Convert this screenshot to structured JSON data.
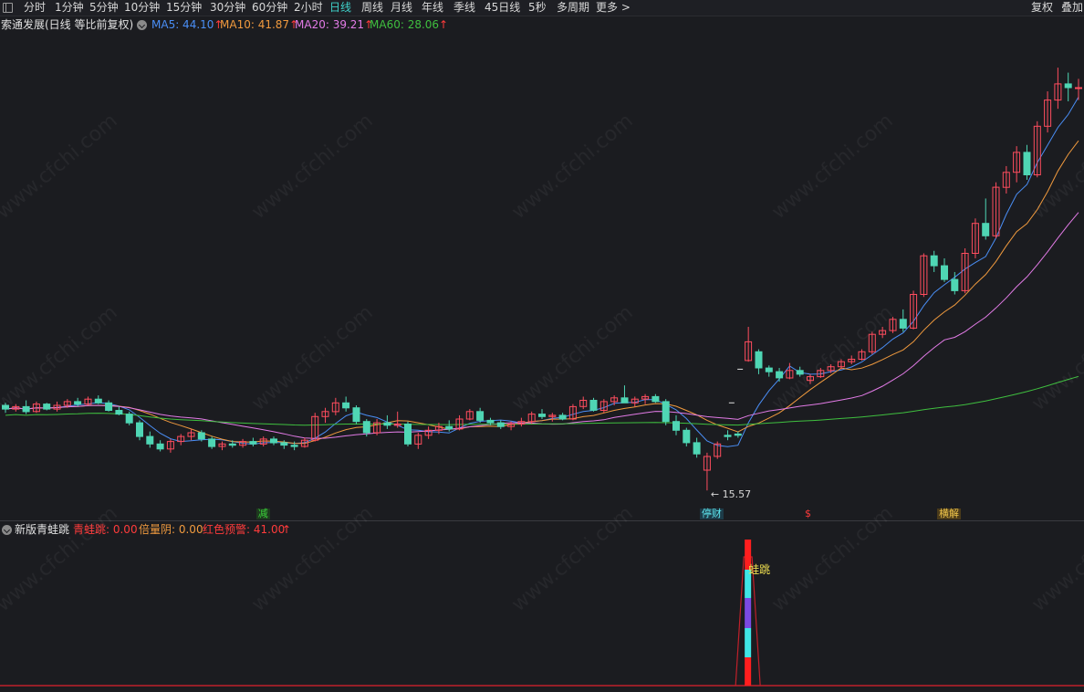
{
  "toolbar": {
    "periods": [
      "分时",
      "1分钟",
      "5分钟",
      "10分钟",
      "15分钟",
      "30分钟",
      "60分钟",
      "2小时",
      "日线",
      "周线",
      "月线",
      "年线",
      "季线",
      "45日线",
      "5秒",
      "多周期",
      "更多 >"
    ],
    "active_period": "日线",
    "right_buttons": [
      "复权",
      "叠加"
    ]
  },
  "legend": {
    "title": "索通发展(日线 等比前复权)",
    "ma": [
      {
        "label": "MA5: 44.10",
        "arrow": "↑",
        "color": "#4a8ef5"
      },
      {
        "label": "MA10: 41.87",
        "arrow": "↑",
        "color": "#f09a3e"
      },
      {
        "label": "MA20: 39.21",
        "arrow": "↑",
        "color": "#e27be6"
      },
      {
        "label": "MA60: 28.06",
        "arrow": "↑",
        "color": "#3fbf3f"
      }
    ],
    "arrow_color": "#ff3b3b"
  },
  "annotations": {
    "low_price": "15.57",
    "signals": [
      {
        "text": "减",
        "color": "#3ad13a",
        "bg": "#1e3a1e"
      },
      {
        "text": "停财",
        "color": "#5ee8f0",
        "bg": "#1d3b48"
      },
      {
        "text": "$",
        "color": "#ff3b3b",
        "bg": "transparent"
      },
      {
        "text": "横解",
        "color": "#f0c54a",
        "bg": "#4a3a1a"
      }
    ]
  },
  "indicator": {
    "title": "新版青蛙跳",
    "items": [
      {
        "label": "青蛙跳: 0.00",
        "color": "#ff3b3b"
      },
      {
        "label": "倍量阴: 0.00",
        "color": "#f09a3e"
      },
      {
        "label": "红色预警: 41.00",
        "color": "#ff3b3b"
      }
    ],
    "arrow": "↑",
    "bar_label": "蛙跳"
  },
  "watermark": "www.cfchi.com",
  "colors": {
    "up": "#ff4d5e",
    "down": "#4fd6b4",
    "background": "#1b1c20"
  },
  "chart_data": {
    "type": "candlestick",
    "series_name": "索通发展",
    "period": "日线",
    "ylim": [
      15,
      52
    ],
    "candles": [
      [
        22.4,
        22.6,
        21.8,
        22.1
      ],
      [
        22.1,
        22.5,
        21.9,
        22.3
      ],
      [
        22.3,
        22.8,
        21.7,
        21.9
      ],
      [
        21.9,
        22.7,
        21.8,
        22.5
      ],
      [
        22.5,
        22.6,
        22.0,
        22.1
      ],
      [
        22.1,
        22.7,
        21.9,
        22.4
      ],
      [
        22.4,
        22.9,
        22.2,
        22.7
      ],
      [
        22.7,
        23.0,
        22.3,
        22.5
      ],
      [
        22.5,
        23.1,
        22.4,
        22.9
      ],
      [
        22.9,
        23.2,
        22.5,
        22.6
      ],
      [
        22.6,
        22.8,
        21.9,
        22.0
      ],
      [
        22.0,
        22.3,
        21.6,
        21.7
      ],
      [
        21.7,
        21.9,
        20.8,
        21.0
      ],
      [
        21.0,
        21.2,
        19.6,
        19.9
      ],
      [
        19.9,
        20.3,
        19.0,
        19.3
      ],
      [
        19.3,
        19.6,
        18.7,
        18.9
      ],
      [
        18.9,
        19.7,
        18.6,
        19.5
      ],
      [
        19.5,
        20.1,
        19.2,
        19.9
      ],
      [
        19.9,
        20.5,
        19.6,
        20.2
      ],
      [
        20.2,
        20.4,
        19.5,
        19.7
      ],
      [
        19.7,
        19.9,
        18.9,
        19.1
      ],
      [
        19.1,
        19.5,
        18.8,
        19.3
      ],
      [
        19.3,
        19.6,
        19.0,
        19.2
      ],
      [
        19.2,
        19.7,
        19.0,
        19.5
      ],
      [
        19.5,
        19.8,
        19.1,
        19.3
      ],
      [
        19.3,
        19.9,
        19.1,
        19.7
      ],
      [
        19.7,
        19.9,
        19.2,
        19.4
      ],
      [
        19.4,
        19.6,
        18.9,
        19.2
      ],
      [
        19.2,
        19.5,
        18.8,
        19.1
      ],
      [
        19.1,
        19.8,
        19.0,
        19.6
      ],
      [
        19.6,
        21.8,
        19.5,
        21.5
      ],
      [
        21.5,
        22.2,
        21.0,
        21.9
      ],
      [
        21.9,
        23.0,
        21.6,
        22.6
      ],
      [
        22.6,
        23.1,
        21.9,
        22.2
      ],
      [
        22.2,
        22.4,
        20.9,
        21.1
      ],
      [
        21.1,
        21.3,
        19.9,
        20.2
      ],
      [
        20.2,
        21.3,
        20.0,
        21.0
      ],
      [
        21.0,
        21.6,
        20.5,
        20.8
      ],
      [
        20.8,
        21.9,
        20.6,
        20.9
      ],
      [
        20.9,
        21.1,
        19.1,
        19.3
      ],
      [
        19.3,
        20.2,
        18.9,
        20.0
      ],
      [
        20.0,
        20.7,
        19.7,
        20.4
      ],
      [
        20.4,
        21.0,
        20.1,
        20.7
      ],
      [
        20.7,
        21.2,
        20.3,
        20.5
      ],
      [
        20.5,
        21.6,
        20.4,
        21.3
      ],
      [
        21.3,
        22.1,
        21.2,
        21.9
      ],
      [
        21.9,
        22.2,
        21.0,
        21.2
      ],
      [
        21.2,
        21.4,
        20.8,
        21.0
      ],
      [
        21.0,
        21.2,
        20.5,
        20.7
      ],
      [
        20.7,
        21.1,
        20.4,
        20.9
      ],
      [
        20.9,
        21.4,
        20.7,
        21.1
      ],
      [
        21.1,
        21.9,
        20.9,
        21.7
      ],
      [
        21.7,
        22.1,
        21.3,
        21.5
      ],
      [
        21.5,
        21.8,
        21.1,
        21.6
      ],
      [
        21.6,
        21.8,
        21.2,
        21.3
      ],
      [
        21.3,
        22.5,
        21.2,
        22.3
      ],
      [
        22.3,
        23.1,
        22.1,
        22.8
      ],
      [
        22.8,
        23.0,
        21.9,
        22.0
      ],
      [
        22.0,
        22.9,
        21.8,
        22.7
      ],
      [
        22.7,
        23.2,
        22.4,
        23.0
      ],
      [
        23.0,
        24.0,
        22.6,
        22.6
      ],
      [
        22.6,
        23.1,
        22.3,
        22.9
      ],
      [
        22.9,
        23.3,
        22.5,
        23.1
      ],
      [
        23.1,
        23.3,
        22.6,
        22.7
      ],
      [
        22.7,
        22.9,
        20.8,
        21.1
      ],
      [
        21.1,
        21.6,
        20.0,
        20.4
      ],
      [
        20.4,
        20.6,
        19.1,
        19.4
      ],
      [
        19.4,
        19.8,
        18.2,
        18.5
      ],
      [
        17.2,
        18.6,
        15.57,
        18.3
      ],
      [
        18.3,
        19.5,
        18.1,
        19.3
      ],
      [
        20.0,
        20.4,
        19.6,
        19.9
      ],
      [
        20.1,
        20.3,
        19.8,
        20.0
      ],
      [
        26.0,
        28.7,
        25.9,
        27.5
      ],
      [
        26.7,
        26.9,
        24.9,
        25.4
      ],
      [
        25.4,
        25.6,
        24.7,
        25.1
      ],
      [
        25.1,
        25.4,
        24.3,
        24.6
      ],
      [
        24.6,
        25.8,
        24.5,
        25.2
      ],
      [
        25.2,
        25.5,
        24.7,
        24.9
      ],
      [
        24.4,
        24.9,
        24.1,
        24.7
      ],
      [
        24.7,
        25.4,
        24.6,
        25.2
      ],
      [
        25.2,
        25.7,
        25.0,
        25.5
      ],
      [
        25.5,
        26.1,
        25.3,
        25.9
      ],
      [
        25.9,
        26.4,
        25.7,
        26.1
      ],
      [
        26.1,
        26.9,
        26.0,
        26.7
      ],
      [
        26.7,
        28.3,
        26.5,
        28.1
      ],
      [
        28.1,
        28.7,
        27.8,
        28.4
      ],
      [
        28.4,
        29.5,
        28.2,
        29.3
      ],
      [
        29.3,
        30.1,
        28.3,
        28.6
      ],
      [
        28.6,
        31.6,
        28.5,
        31.3
      ],
      [
        31.3,
        34.6,
        31.1,
        34.4
      ],
      [
        34.4,
        34.8,
        33.1,
        33.6
      ],
      [
        33.6,
        34.2,
        32.3,
        32.5
      ],
      [
        32.5,
        33.1,
        31.3,
        31.6
      ],
      [
        31.6,
        35.0,
        31.4,
        34.6
      ],
      [
        34.6,
        37.4,
        34.2,
        37.0
      ],
      [
        37.0,
        39.0,
        35.7,
        36.0
      ],
      [
        36.0,
        40.3,
        35.8,
        39.9
      ],
      [
        39.9,
        41.6,
        39.4,
        41.1
      ],
      [
        41.1,
        43.2,
        40.3,
        42.7
      ],
      [
        42.7,
        43.3,
        40.5,
        40.9
      ],
      [
        40.9,
        45.2,
        40.7,
        44.8
      ],
      [
        44.8,
        47.6,
        44.3,
        46.9
      ],
      [
        46.9,
        49.5,
        46.2,
        48.2
      ],
      [
        48.2,
        49.1,
        46.8,
        47.9
      ],
      [
        47.9,
        48.6,
        46.9,
        47.9
      ]
    ]
  }
}
